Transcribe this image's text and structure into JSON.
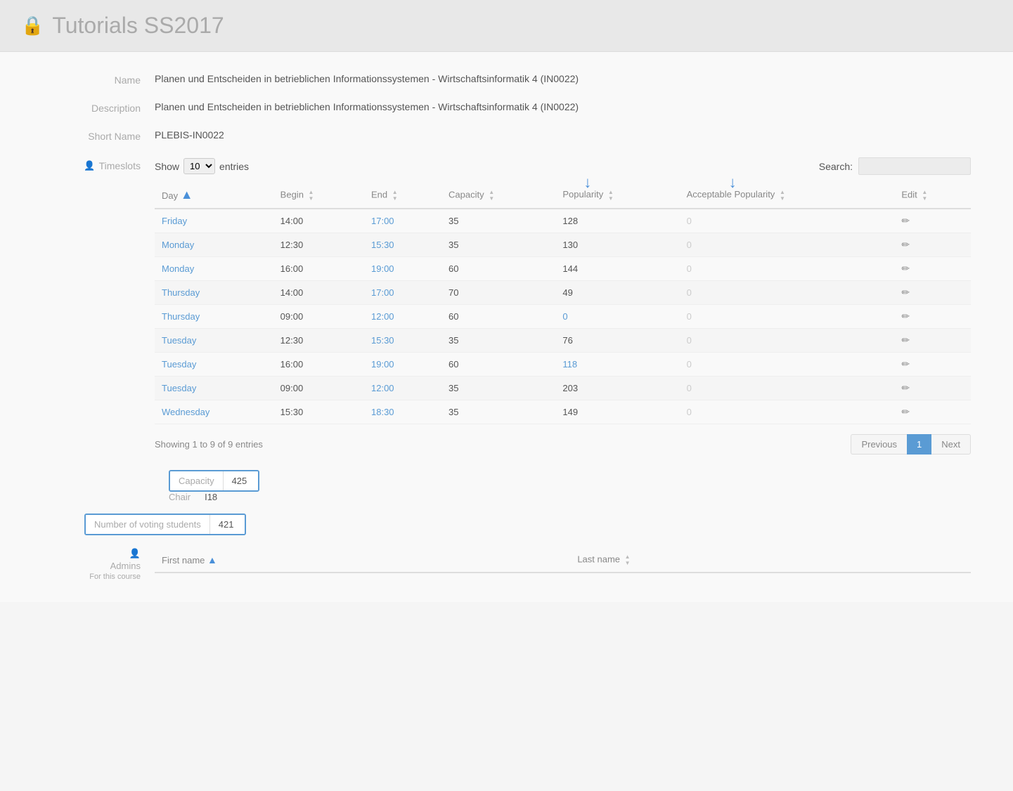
{
  "header": {
    "lock_icon": "🔒",
    "title": "Tutorials SS2017"
  },
  "fields": {
    "name_label": "Name",
    "name_value": "Planen und Entscheiden in betrieblichen Informationssystemen - Wirtschaftsinformatik 4 (IN0022)",
    "description_label": "Description",
    "description_value": "Planen und Entscheiden in betrieblichen Informationssystemen - Wirtschaftsinformatik 4 (IN0022)",
    "short_name_label": "Short Name",
    "short_name_value": "PLEBIS-IN0022",
    "timeslots_label": "Timeslots"
  },
  "table_controls": {
    "show_label": "Show",
    "entries_label": "entries",
    "show_value": "10",
    "search_label": "Search:",
    "search_placeholder": ""
  },
  "table": {
    "columns": [
      "Day",
      "Begin",
      "End",
      "Capacity",
      "Popularity",
      "Acceptable Popularity",
      "Edit"
    ],
    "rows": [
      {
        "day": "Friday",
        "begin": "14:00",
        "end": "17:00",
        "capacity": "35",
        "popularity": "128",
        "acceptable_popularity": "0",
        "is_blue_popularity": false
      },
      {
        "day": "Monday",
        "begin": "12:30",
        "end": "15:30",
        "capacity": "35",
        "popularity": "130",
        "acceptable_popularity": "0",
        "is_blue_popularity": false
      },
      {
        "day": "Monday",
        "begin": "16:00",
        "end": "19:00",
        "capacity": "60",
        "popularity": "144",
        "acceptable_popularity": "0",
        "is_blue_popularity": false
      },
      {
        "day": "Thursday",
        "begin": "14:00",
        "end": "17:00",
        "capacity": "70",
        "popularity": "49",
        "acceptable_popularity": "0",
        "is_blue_popularity": false
      },
      {
        "day": "Thursday",
        "begin": "09:00",
        "end": "12:00",
        "capacity": "60",
        "popularity": "0",
        "acceptable_popularity": "0",
        "is_blue_popularity": true
      },
      {
        "day": "Tuesday",
        "begin": "12:30",
        "end": "15:30",
        "capacity": "35",
        "popularity": "76",
        "acceptable_popularity": "0",
        "is_blue_popularity": false
      },
      {
        "day": "Tuesday",
        "begin": "16:00",
        "end": "19:00",
        "capacity": "60",
        "popularity": "118",
        "acceptable_popularity": "0",
        "is_blue_popularity": true
      },
      {
        "day": "Tuesday",
        "begin": "09:00",
        "end": "12:00",
        "capacity": "35",
        "popularity": "203",
        "acceptable_popularity": "0",
        "is_blue_popularity": false
      },
      {
        "day": "Wednesday",
        "begin": "15:30",
        "end": "18:30",
        "capacity": "35",
        "popularity": "149",
        "acceptable_popularity": "0",
        "is_blue_popularity": false
      }
    ],
    "showing_text": "Showing 1 to 9 of 9 entries"
  },
  "pagination": {
    "previous_label": "Previous",
    "next_label": "Next",
    "current_page": "1"
  },
  "capacity": {
    "label": "Capacity",
    "value": "425"
  },
  "chair": {
    "label": "Chair",
    "value": "I18"
  },
  "voting": {
    "label": "Number of voting students",
    "value": "421"
  },
  "admins": {
    "person_icon": "👤",
    "label": "Admins",
    "sublabel": "For this course",
    "columns": [
      "First name",
      "Last name"
    ]
  }
}
